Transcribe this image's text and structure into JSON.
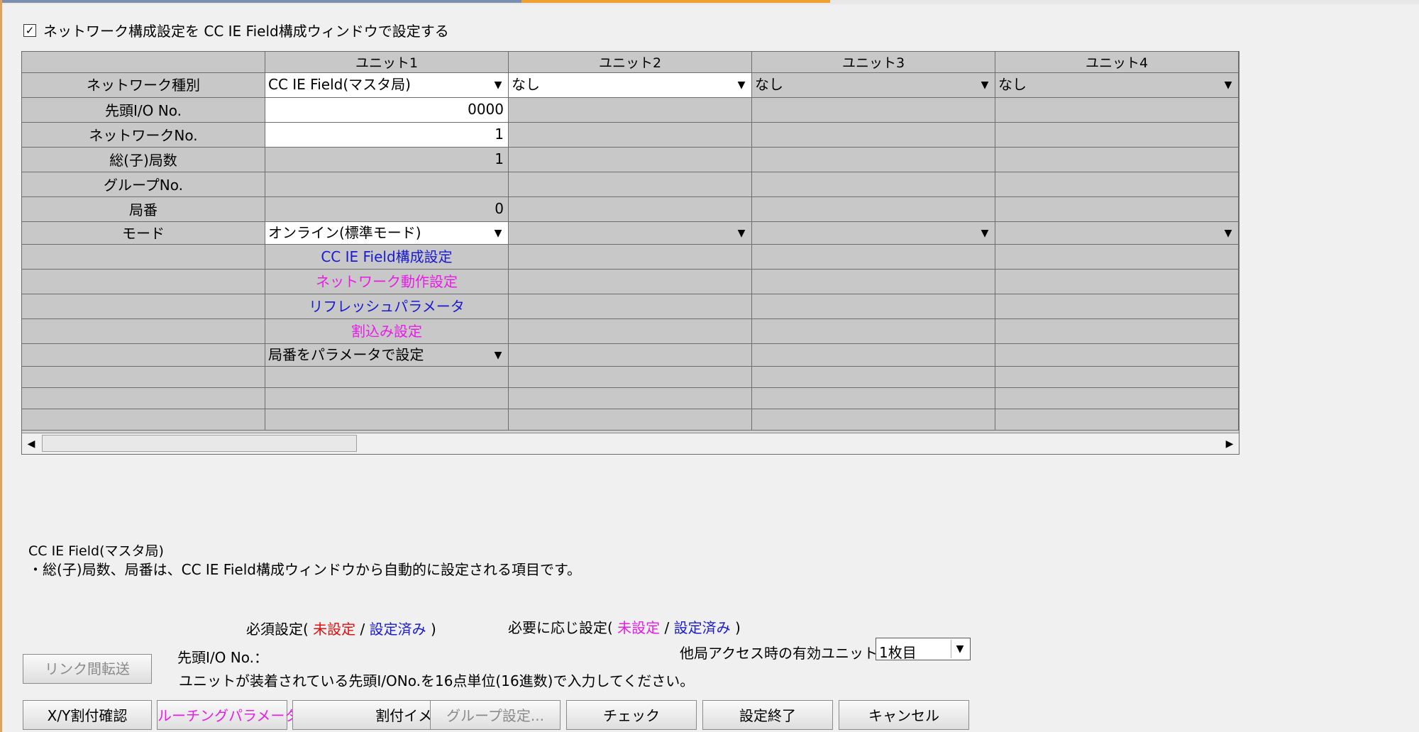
{
  "top_checkbox": {
    "checked_mark": "✓",
    "label": "ネットワーク構成設定を CC IE Field構成ウィンドウで設定する"
  },
  "grid": {
    "columns": [
      "ユニット1",
      "ユニット2",
      "ユニット3",
      "ユニット4"
    ],
    "row_labels": {
      "network_type": "ネットワーク種別",
      "start_io": "先頭I/O No.",
      "network_no": "ネットワークNo.",
      "total_stations": "総(子)局数",
      "group_no": "グループNo.",
      "station_no": "局番",
      "mode": "モード"
    },
    "unit1": {
      "network_type": "CC IE Field(マスタ局)",
      "start_io": "0000",
      "network_no": "1",
      "total_stations": "1",
      "station_no": "0",
      "mode": "オンライン(標準モード)",
      "btn_config": "CC IE Field構成設定",
      "btn_netop": "ネットワーク動作設定",
      "btn_refresh": "リフレッシュパラメータ",
      "btn_interrupt": "割込み設定",
      "station_setting": "局番をパラメータで設定"
    },
    "unit2": {
      "network_type": "なし"
    },
    "unit3": {
      "network_type": "なし"
    },
    "unit4": {
      "network_type": "なし"
    },
    "dropdown_icon": "▼"
  },
  "notes": {
    "line1": "CC IE Field(マスタ局)",
    "line2": "・総(子)局数、局番は、CC IE Field構成ウィンドウから自動的に設定される項目です。"
  },
  "legend": {
    "required_prefix": "必須設定(",
    "unset": "未設定",
    "slash": "/",
    "set": "設定済み",
    "close": ")",
    "optional_prefix": "必要に応じ設定(",
    "colors": {
      "required_unset": "#e01010",
      "optional_unset": "#e81ce8",
      "set": "#1a1ad0"
    }
  },
  "io_help": {
    "label": "先頭I/O No.：",
    "text": "ユニットが装着されている先頭I/ONo.を16点単位(16進数)で入力してください。"
  },
  "access_unit": {
    "label": "他局アクセス時の有効ユニット",
    "value": "1枚目"
  },
  "buttons": {
    "link_transfer": "リンク間転送",
    "xy_check": "X/Y割付確認",
    "routing": "ルーチングパラメータ",
    "assign_image": "割付イメージ図",
    "group_setting": "グループ設定...",
    "check": "チェック",
    "finish": "設定終了",
    "cancel": "キャンセル"
  }
}
